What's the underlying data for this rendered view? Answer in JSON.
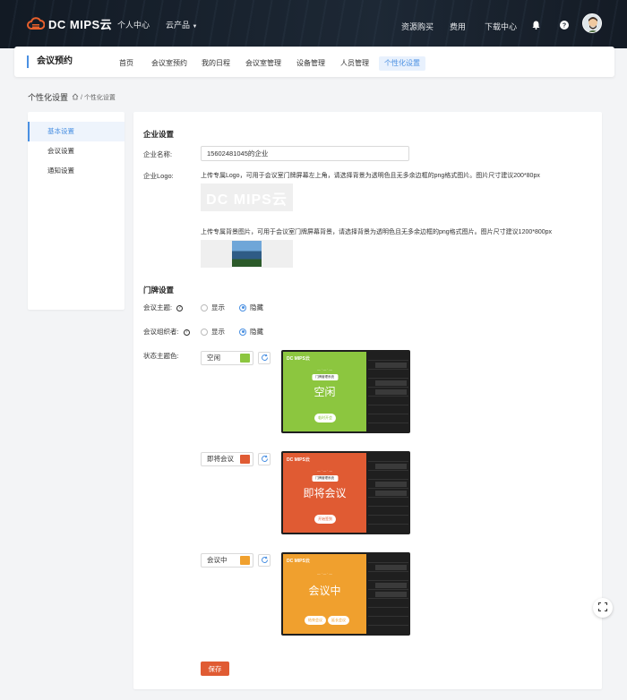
{
  "topnav": {
    "brand": "DC MIPS云",
    "links": [
      "个人中心",
      "云产品"
    ],
    "right_links": [
      "资源购买",
      "费用",
      "下载中心"
    ],
    "icons": [
      "bell-icon",
      "help-icon"
    ]
  },
  "subheader": {
    "title": "会议预约",
    "tabs": [
      {
        "label": "首页",
        "active": false
      },
      {
        "label": "会议室预约",
        "active": false
      },
      {
        "label": "我的日程",
        "active": false
      },
      {
        "label": "会议室管理",
        "active": false
      },
      {
        "label": "设备管理",
        "active": false
      },
      {
        "label": "人员管理",
        "active": false
      },
      {
        "label": "个性化设置",
        "active": true
      }
    ]
  },
  "breadcrumb": {
    "title": "个性化设置",
    "path": "/ 个性化设置"
  },
  "sidemenu": {
    "items": [
      {
        "label": "基本设置",
        "active": true
      },
      {
        "label": "会议设置",
        "active": false
      },
      {
        "label": "通知设置",
        "active": false
      }
    ]
  },
  "enterprise": {
    "section_title": "企业设置",
    "name_label": "企业名称:",
    "name_value": "15602481045的企业",
    "logo_label": "企业Logo:",
    "logo_note": "上传专属Logo，可用于会议室门牌屏幕左上角，请选择背景为透明色且无多余边框的png格式图片。图片尺寸建议200*80px",
    "logo_text": "DC MIPS云",
    "bg_note": "上传专属背景图片，可用于会议室门牌屏幕背景，请选择背景为透明色且无多余边框的png格式图片。图片尺寸建议1200*800px"
  },
  "doorplate": {
    "section_title": "门牌设置",
    "topic_label": "会议主题:",
    "organizer_label": "会议组织者:",
    "show_label": "显示",
    "hide_label": "隐藏",
    "theme_label": "状态主题色:",
    "states": [
      {
        "name": "空闲",
        "color": "#8cc63f",
        "big": "空闲",
        "button": "临时开会"
      },
      {
        "name": "即将会议",
        "color": "#e05b33",
        "big": "即将会议",
        "button": "开始签到"
      },
      {
        "name": "会议中",
        "color": "#f0a02e",
        "big": "会议中",
        "button": "结束会议",
        "button2": "延长会议"
      }
    ],
    "preview_brand": "DC MIPS云",
    "preview_tag": "门牌管理系统"
  },
  "save_label": "保存"
}
